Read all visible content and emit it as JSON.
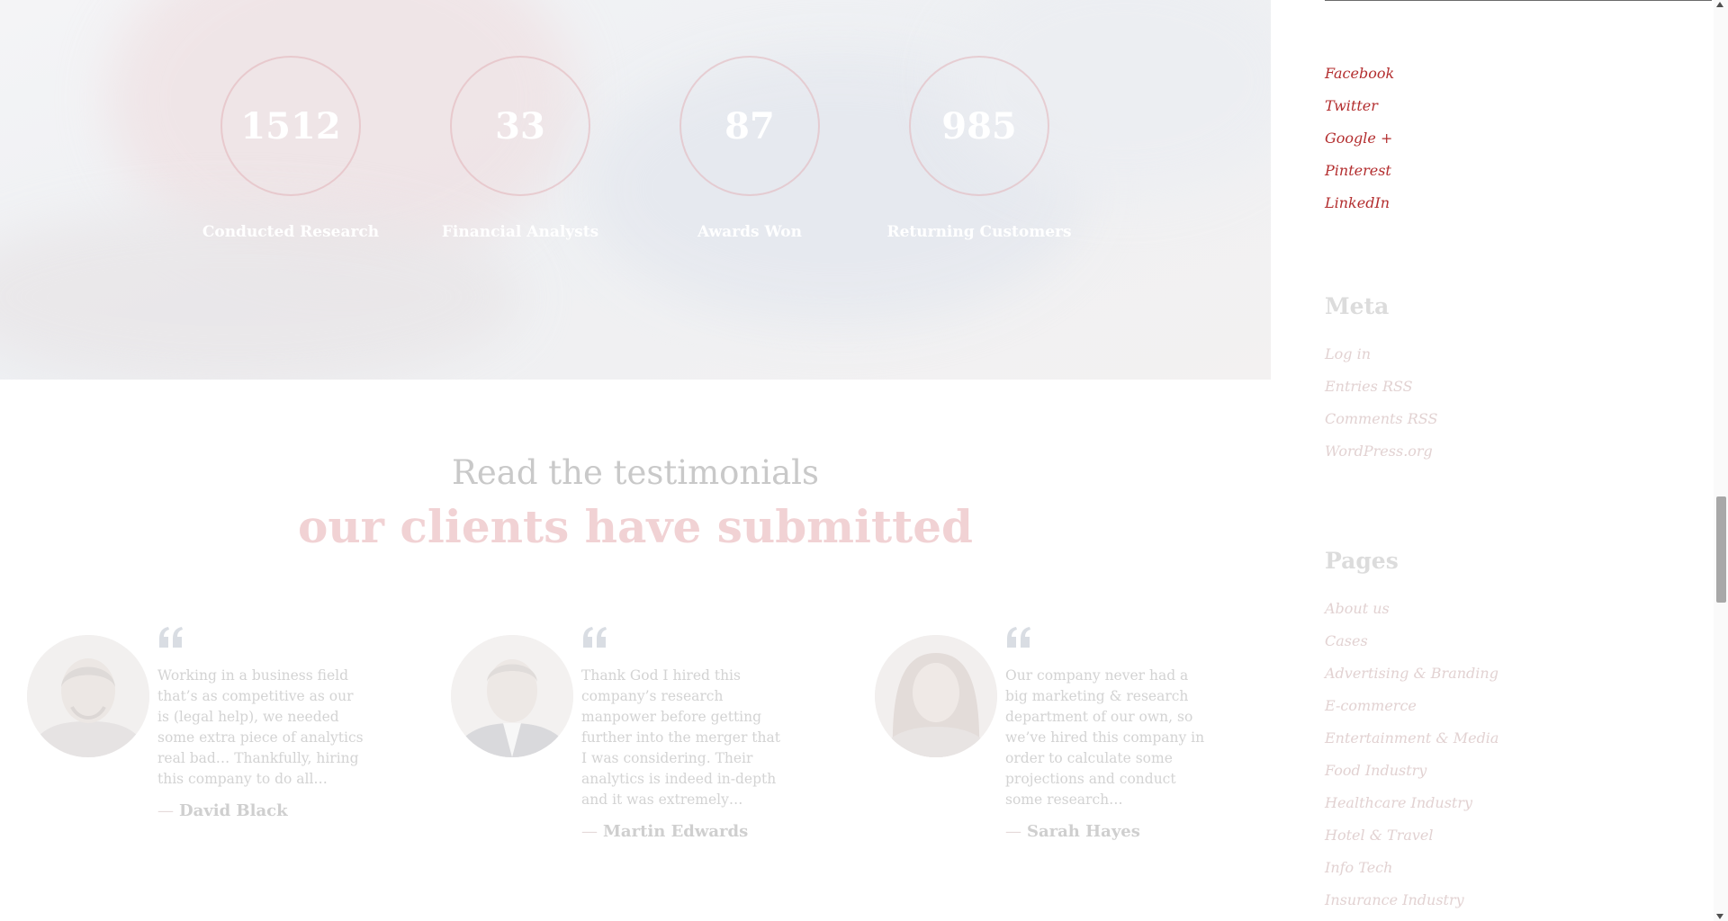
{
  "counters": [
    {
      "value": "1512",
      "label": "Conducted Research"
    },
    {
      "value": "33",
      "label": "Financial Analysts"
    },
    {
      "value": "87",
      "label": "Awards Won"
    },
    {
      "value": "985",
      "label": "Returning Customers"
    }
  ],
  "testimonials": {
    "heading_line1": "Read the testimonials",
    "heading_line2": "our clients have submitted",
    "items": [
      {
        "text": "Working in a business field that’s as competitive as our is (legal help), we needed some extra piece of analytics real bad… Thankfully, hiring this company to do all…",
        "author": "David Black"
      },
      {
        "text": "Thank God I hired this company’s research manpower before getting further into the merger that I was considering. Their analytics is indeed in-depth and it was extremely…",
        "author": "Martin Edwards"
      },
      {
        "text": "Our company never had a big marketing & research department of our own, so we’ve hired this company in order to calculate some projections and conduct some research…",
        "author": "Sarah Hayes"
      }
    ],
    "dash": "—"
  },
  "sidebar": {
    "social": [
      "Facebook",
      "Twitter",
      "Google +",
      "Pinterest",
      "LinkedIn"
    ],
    "meta_title": "Meta",
    "meta_links": [
      "Log in",
      "Entries RSS",
      "Comments RSS",
      "WordPress.org"
    ],
    "pages_title": "Pages",
    "pages_links": [
      "About us",
      "Cases",
      "Advertising & Branding",
      "E-commerce",
      "Entertainment & Media",
      "Food Industry",
      "Healthcare Industry",
      "Hotel & Travel",
      "Info Tech",
      "Insurance Industry"
    ]
  },
  "colors": {
    "accent": "#b32d2e",
    "heading_pink": "#f1d2d4",
    "muted_text": "#d3d3d3"
  }
}
